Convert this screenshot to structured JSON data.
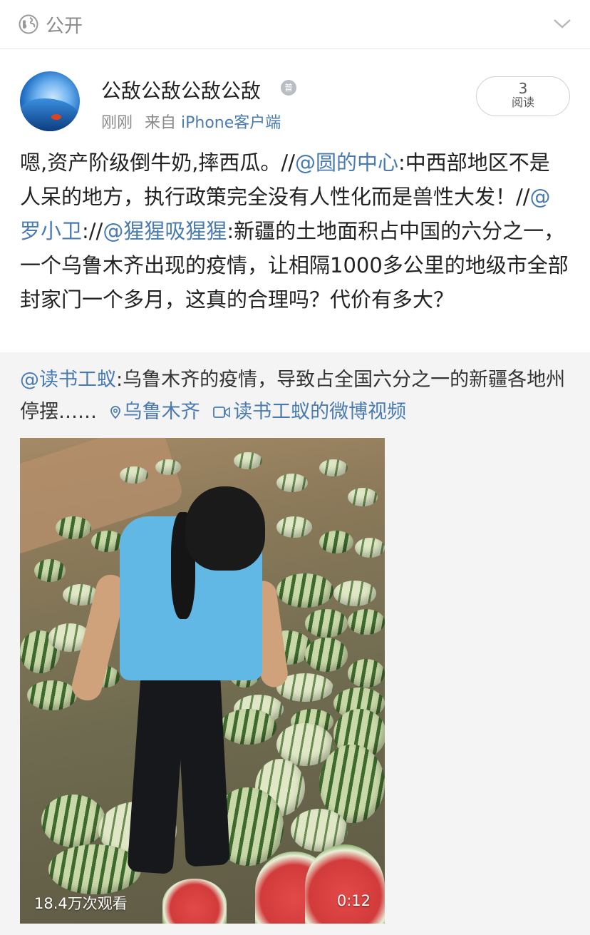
{
  "visibility": {
    "icon": "globe-icon",
    "label": "公开",
    "dropdown_icon": "chevron-down-icon"
  },
  "author": {
    "name": "公敌公敌公敌公敌",
    "badge_icon": "medal-icon",
    "badge_text": "普",
    "time": "刚刚",
    "source_prefix": "来自",
    "source": "iPhone客户端"
  },
  "reads": {
    "count": "3",
    "label": "阅读"
  },
  "post": {
    "segments": [
      {
        "type": "text",
        "text": "嗯,资产阶级倒牛奶,摔西瓜。//"
      },
      {
        "type": "mention",
        "text": "@圆的中心"
      },
      {
        "type": "text",
        "text": ":中西部地区不是人呆的地方，执行政策完全没有人性化而是兽性大发！//"
      },
      {
        "type": "mention",
        "text": "@罗小卫"
      },
      {
        "type": "text",
        "text": "://"
      },
      {
        "type": "mention",
        "text": "@猩猩吸猩猩"
      },
      {
        "type": "text",
        "text": ":新疆的土地面积占中国的六分之一，一个乌鲁木齐出现的疫情，让相隔1000多公里的地级市全部封家门一个多月，这真的合理吗？代价有多大？"
      }
    ]
  },
  "repost": {
    "author_mention": "@读书工蚁",
    "text": ":乌鲁木齐的疫情，导致占全国六分之一的新疆各地州停摆……",
    "location_icon": "location-pin-icon",
    "location": "乌鲁木齐",
    "video_link_icon": "video-icon",
    "video_link": "读书工蚁的微博视频"
  },
  "video": {
    "views": "18.4万次观看",
    "duration": "0:12"
  },
  "colors": {
    "link": "#4a7bb0",
    "repost_bg": "#f4f4f4",
    "meta": "#8a8a8a"
  }
}
